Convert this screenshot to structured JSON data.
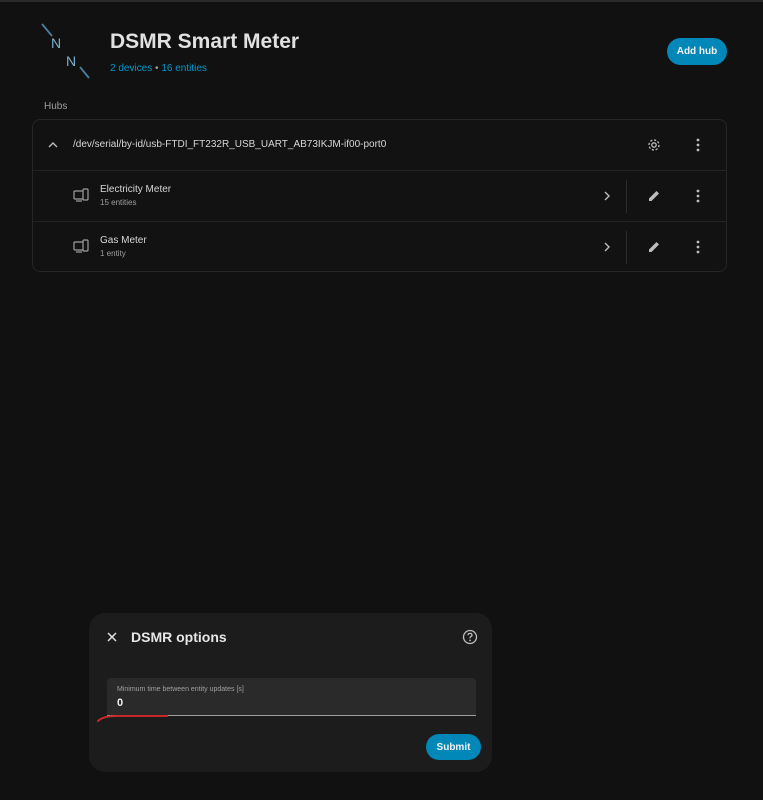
{
  "header": {
    "title": "DSMR Smart Meter",
    "devices_link": "2 devices",
    "separator": "•",
    "entities_link": "16 entities",
    "add_hub_label": "Add hub",
    "logo_icon": "dsmr-logo-icon"
  },
  "section_label": "Hubs",
  "hub": {
    "path": "/dev/serial/by-id/usb-FTDI_FT232R_USB_UART_AB73IKJM-if00-port0",
    "devices": [
      {
        "name": "Electricity Meter",
        "entities": "15 entities"
      },
      {
        "name": "Gas Meter",
        "entities": "1 entity"
      }
    ]
  },
  "dialog": {
    "title": "DSMR options",
    "field_label": "Minimum time between entity updates [s]",
    "field_value": "0",
    "submit_label": "Submit"
  },
  "colors": {
    "accent": "#0288b8",
    "link": "#0099cc",
    "annotation": "#c62828"
  }
}
